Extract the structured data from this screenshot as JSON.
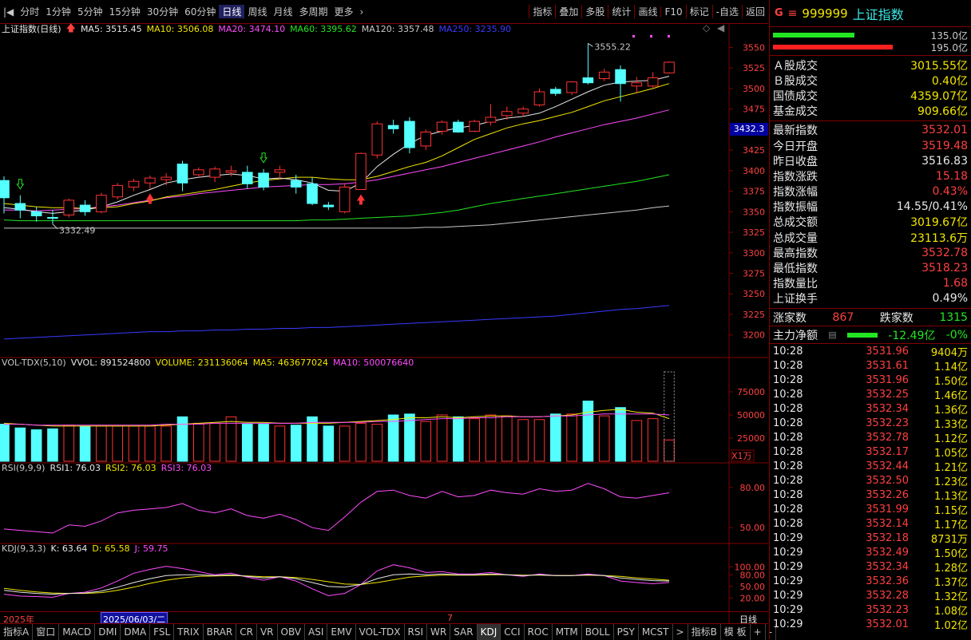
{
  "toolbar": {
    "periods": [
      "分时",
      "1分钟",
      "5分钟",
      "15分钟",
      "30分钟",
      "60分钟",
      "日线",
      "周线",
      "月线",
      "多周期",
      "更多"
    ],
    "active_period": "日线",
    "right_buttons": [
      "指标",
      "叠加",
      "多股",
      "统计",
      "画线",
      "F10",
      "标记",
      "-自选",
      "返回"
    ]
  },
  "main_chart": {
    "title": "上证指数(日线)",
    "ma_labels": [
      {
        "text": "MA5: 3515.45",
        "color": "#e8e8e8"
      },
      {
        "text": "MA10: 3506.08",
        "color": "#f2e600"
      },
      {
        "text": "MA20: 3474.10",
        "color": "#ff4cff"
      },
      {
        "text": "MA60: 3395.62",
        "color": "#22e622"
      },
      {
        "text": "MA120: 3357.48",
        "color": "#c8c8c8"
      },
      {
        "text": "MA250: 3235.90",
        "color": "#3a3aff"
      }
    ],
    "high_label": "3555.22",
    "low_label": "3332.49",
    "current_price_tag": "3432.3",
    "y_ticks": [
      "3550",
      "3525",
      "3500",
      "3475",
      "3450",
      "3425",
      "3400",
      "3375",
      "3350",
      "3325",
      "3300",
      "3275",
      "3250",
      "3225",
      "3200"
    ]
  },
  "vol_panel": {
    "labels": [
      {
        "text": "VOL-TDX(5,10)",
        "color": "#c8c8c8"
      },
      {
        "text": "VVOL: 891524800",
        "color": "#e8e8e8"
      },
      {
        "text": "VOLUME: 231136064",
        "color": "#f2e600"
      },
      {
        "text": "MA5: 463677024",
        "color": "#f2e600"
      },
      {
        "text": "MA10: 500076640",
        "color": "#ff4cff"
      }
    ],
    "y_ticks": [
      "75000",
      "50000",
      "25000"
    ],
    "unit": "X1万"
  },
  "rsi_panel": {
    "labels": [
      {
        "text": "RSI(9,9,9)",
        "color": "#c8c8c8"
      },
      {
        "text": "RSI1: 76.03",
        "color": "#e8e8e8"
      },
      {
        "text": "RSI2: 76.03",
        "color": "#f2e600"
      },
      {
        "text": "RSI3: 76.03",
        "color": "#ff4cff"
      }
    ],
    "y_ticks": [
      "80.00",
      "50.00"
    ]
  },
  "kdj_panel": {
    "labels": [
      {
        "text": "KDJ(9,3,3)",
        "color": "#c8c8c8"
      },
      {
        "text": "K: 63.64",
        "color": "#e8e8e8"
      },
      {
        "text": "D: 65.58",
        "color": "#f2e600"
      },
      {
        "text": "J: 59.75",
        "color": "#ff4cff"
      }
    ],
    "y_ticks": [
      "100.00",
      "80.00",
      "50.00",
      "20.00"
    ]
  },
  "time_axis": {
    "year": "2025年",
    "date_tag": "2025/06/03/二",
    "month_mark": "7",
    "period": "日线"
  },
  "bottom_tabs": [
    "指标A",
    "窗口",
    "MACD",
    "DMI",
    "DMA",
    "FSL",
    "TRIX",
    "BRAR",
    "CR",
    "VR",
    "OBV",
    "ASI",
    "EMV",
    "VOL-TDX",
    "RSI",
    "WR",
    "SAR",
    "KDJ",
    "CCI",
    "ROC",
    "MTM",
    "BOLL",
    "PSY",
    "MCST"
  ],
  "bottom_tabs_active": "KDJ",
  "bottom_right": [
    "指标B",
    "模 板",
    "+",
    "-"
  ],
  "quote": {
    "prefix": "G",
    "menu_icon": "≡",
    "code": "999999",
    "name": "上证指数",
    "bar1_value": "135.0亿",
    "bar2_value": "195.0亿",
    "turnover_rows": [
      {
        "k": "Ａ股成交",
        "v": "3015.55亿"
      },
      {
        "k": "Ｂ股成交",
        "v": "0.40亿"
      },
      {
        "k": "国债成交",
        "v": "4359.07亿"
      },
      {
        "k": "基金成交",
        "v": "909.66亿"
      }
    ],
    "index_rows": [
      {
        "k": "最新指数",
        "v": "3532.01",
        "c": "#ff4040"
      },
      {
        "k": "今日开盘",
        "v": "3519.48",
        "c": "#ff4040"
      },
      {
        "k": "昨日收盘",
        "v": "3516.83",
        "c": "#e8e8e8"
      },
      {
        "k": "指数涨跌",
        "v": "15.18",
        "c": "#ff4040"
      },
      {
        "k": "指数涨幅",
        "v": "0.43%",
        "c": "#ff4040"
      },
      {
        "k": "指数振幅",
        "v": "14.55/0.41%",
        "c": "#e8e8e8"
      },
      {
        "k": "总成交额",
        "v": "3019.67亿",
        "c": "#f2e600"
      },
      {
        "k": "总成交量",
        "v": "23113.6万",
        "c": "#f2e600"
      },
      {
        "k": "最高指数",
        "v": "3532.78",
        "c": "#ff4040"
      },
      {
        "k": "最低指数",
        "v": "3518.23",
        "c": "#ff4040"
      },
      {
        "k": "指数量比",
        "v": "1.68",
        "c": "#ff4040"
      },
      {
        "k": "上证换手",
        "v": "0.49%",
        "c": "#e8e8e8"
      }
    ],
    "breadth": {
      "up_label": "涨家数",
      "up": "867",
      "down_label": "跌家数",
      "down": "1315"
    },
    "mainflow": {
      "label": "主力净额",
      "value": "-12.49亿",
      "pct": "-0%"
    },
    "ticks": [
      {
        "t": "10:28",
        "p": "3531.96",
        "v": "9404万"
      },
      {
        "t": "10:28",
        "p": "3531.61",
        "v": "1.14亿"
      },
      {
        "t": "10:28",
        "p": "3531.96",
        "v": "1.50亿"
      },
      {
        "t": "10:28",
        "p": "3532.25",
        "v": "1.46亿"
      },
      {
        "t": "10:28",
        "p": "3532.34",
        "v": "1.36亿"
      },
      {
        "t": "10:28",
        "p": "3532.23",
        "v": "1.33亿"
      },
      {
        "t": "10:28",
        "p": "3532.78",
        "v": "1.12亿"
      },
      {
        "t": "10:28",
        "p": "3532.17",
        "v": "1.05亿"
      },
      {
        "t": "10:28",
        "p": "3532.44",
        "v": "1.21亿"
      },
      {
        "t": "10:28",
        "p": "3532.50",
        "v": "1.23亿"
      },
      {
        "t": "10:28",
        "p": "3532.26",
        "v": "1.13亿"
      },
      {
        "t": "10:28",
        "p": "3531.99",
        "v": "1.15亿"
      },
      {
        "t": "10:28",
        "p": "3532.14",
        "v": "1.17亿"
      },
      {
        "t": "10:29",
        "p": "3532.18",
        "v": "8731万"
      },
      {
        "t": "10:29",
        "p": "3532.49",
        "v": "1.50亿"
      },
      {
        "t": "10:29",
        "p": "3532.34",
        "v": "1.28亿"
      },
      {
        "t": "10:29",
        "p": "3532.36",
        "v": "1.37亿"
      },
      {
        "t": "10:29",
        "p": "3532.28",
        "v": "1.32亿"
      },
      {
        "t": "10:29",
        "p": "3532.23",
        "v": "1.08亿"
      },
      {
        "t": "10:29",
        "p": "3532.01",
        "v": "1.02亿"
      }
    ]
  },
  "chart_data": {
    "type": "candlestick",
    "candles": [
      [
        3388,
        3393,
        3348,
        3367
      ],
      [
        3360,
        3370,
        3342,
        3352
      ],
      [
        3350,
        3356,
        3338,
        3345
      ],
      [
        3343,
        3352,
        3335,
        3342
      ],
      [
        3346,
        3366,
        3343,
        3364
      ],
      [
        3358,
        3364,
        3345,
        3350
      ],
      [
        3350,
        3373,
        3348,
        3370
      ],
      [
        3368,
        3385,
        3365,
        3382
      ],
      [
        3380,
        3390,
        3375,
        3387
      ],
      [
        3385,
        3394,
        3378,
        3391
      ],
      [
        3389,
        3397,
        3382,
        3392
      ],
      [
        3408,
        3412,
        3375,
        3385
      ],
      [
        3395,
        3404,
        3392,
        3401
      ],
      [
        3392,
        3405,
        3386,
        3402
      ],
      [
        3398,
        3406,
        3393,
        3400
      ],
      [
        3398,
        3406,
        3378,
        3384
      ],
      [
        3397,
        3402,
        3376,
        3380
      ],
      [
        3398,
        3406,
        3389,
        3401
      ],
      [
        3388,
        3395,
        3372,
        3380
      ],
      [
        3384,
        3392,
        3358,
        3360
      ],
      [
        3358,
        3362,
        3352,
        3356
      ],
      [
        3350,
        3385,
        3348,
        3380
      ],
      [
        3377,
        3422,
        3377,
        3421
      ],
      [
        3419,
        3460,
        3415,
        3457
      ],
      [
        3455,
        3462,
        3445,
        3451
      ],
      [
        3460,
        3465,
        3421,
        3428
      ],
      [
        3430,
        3450,
        3425,
        3447
      ],
      [
        3448,
        3461,
        3444,
        3459
      ],
      [
        3459,
        3462,
        3446,
        3447
      ],
      [
        3448,
        3462,
        3447,
        3460
      ],
      [
        3459,
        3481,
        3455,
        3465
      ],
      [
        3467,
        3478,
        3462,
        3472
      ],
      [
        3470,
        3478,
        3466,
        3475
      ],
      [
        3480,
        3500,
        3478,
        3496
      ],
      [
        3499,
        3502,
        3491,
        3494
      ],
      [
        3495,
        3509,
        3492,
        3508
      ],
      [
        3513,
        3555,
        3505,
        3507
      ],
      [
        3512,
        3524,
        3509,
        3520
      ],
      [
        3523,
        3528,
        3484,
        3506
      ],
      [
        3503,
        3514,
        3494,
        3507
      ],
      [
        3503,
        3520,
        3501,
        3513
      ],
      [
        3519,
        3533,
        3518,
        3532
      ]
    ],
    "ma5": [
      3355,
      3353,
      3350,
      3348,
      3350,
      3352,
      3356,
      3362,
      3370,
      3377,
      3385,
      3389,
      3392,
      3394,
      3396,
      3394,
      3390,
      3391,
      3389,
      3385,
      3376,
      3375,
      3385,
      3405,
      3420,
      3433,
      3443,
      3448,
      3452,
      3455,
      3460,
      3464,
      3466,
      3470,
      3478,
      3487,
      3496,
      3504,
      3508,
      3509,
      3510,
      3515
    ],
    "ma10": [
      3360,
      3358,
      3356,
      3355,
      3355,
      3354,
      3355,
      3356,
      3360,
      3363,
      3368,
      3371,
      3374,
      3377,
      3381,
      3385,
      3388,
      3390,
      3392,
      3392,
      3390,
      3389,
      3389,
      3393,
      3399,
      3405,
      3410,
      3418,
      3428,
      3438,
      3445,
      3452,
      3457,
      3461,
      3466,
      3471,
      3478,
      3485,
      3490,
      3495,
      3500,
      3506
    ],
    "ma20": [
      3352,
      3352,
      3351,
      3352,
      3353,
      3354,
      3356,
      3358,
      3361,
      3364,
      3367,
      3369,
      3372,
      3374,
      3376,
      3378,
      3380,
      3381,
      3382,
      3383,
      3383,
      3384,
      3386,
      3389,
      3393,
      3397,
      3401,
      3405,
      3410,
      3415,
      3420,
      3425,
      3430,
      3435,
      3441,
      3446,
      3451,
      3456,
      3460,
      3464,
      3469,
      3474
    ],
    "ma60": [
      3340,
      3339,
      3339,
      3339,
      3339,
      3339,
      3339,
      3339,
      3339,
      3339,
      3339,
      3339,
      3339,
      3339,
      3339,
      3339,
      3339,
      3339,
      3339,
      3340,
      3340,
      3341,
      3342,
      3343,
      3344,
      3345,
      3347,
      3349,
      3352,
      3356,
      3360,
      3363,
      3366,
      3369,
      3372,
      3375,
      3378,
      3381,
      3384,
      3387,
      3391,
      3395
    ],
    "ma120": [
      3330,
      3330,
      3330,
      3330,
      3330,
      3330,
      3330,
      3330,
      3330,
      3330,
      3330,
      3330,
      3330,
      3330,
      3330,
      3330,
      3330,
      3330,
      3330,
      3330,
      3330,
      3330,
      3330,
      3330,
      3330,
      3330,
      3331,
      3331,
      3332,
      3333,
      3334,
      3336,
      3338,
      3340,
      3342,
      3344,
      3346,
      3348,
      3350,
      3352,
      3355,
      3357
    ],
    "ma250": [
      3195,
      3196,
      3197,
      3198,
      3199,
      3200,
      3201,
      3202,
      3203,
      3204,
      3204,
      3205,
      3205,
      3206,
      3206,
      3207,
      3207,
      3208,
      3208,
      3209,
      3209,
      3210,
      3211,
      3212,
      3213,
      3214,
      3215,
      3216,
      3217,
      3218,
      3219,
      3220,
      3221,
      3222,
      3223,
      3225,
      3227,
      3229,
      3231,
      3232,
      3234,
      3236
    ],
    "volume": [
      40000,
      36000,
      34000,
      35000,
      39000,
      38000,
      38000,
      38000,
      38000,
      38000,
      38000,
      48000,
      41000,
      41000,
      48000,
      40000,
      40000,
      38000,
      39000,
      48000,
      38000,
      38000,
      41000,
      40000,
      50000,
      51000,
      43000,
      50000,
      48000,
      46000,
      50000,
      49000,
      45000,
      45000,
      51000,
      51000,
      65000,
      49000,
      58000,
      44000,
      46000,
      23000
    ],
    "vol_ma5": [
      41000,
      40000,
      39000,
      38000,
      38000,
      38000,
      38000,
      38000,
      38000,
      38000,
      39000,
      40000,
      41000,
      42000,
      43000,
      42000,
      42000,
      41000,
      41000,
      41000,
      41000,
      42000,
      43000,
      44000,
      45000,
      47000,
      47000,
      48000,
      47000,
      48000,
      49000,
      49000,
      48000,
      48000,
      49000,
      50000,
      53000,
      55000,
      56000,
      53000,
      52000,
      46000
    ],
    "vol_ma10": [
      40000,
      40000,
      39000,
      39000,
      39000,
      39000,
      39000,
      39000,
      39000,
      39000,
      40000,
      40000,
      40000,
      41000,
      41000,
      41000,
      41000,
      41000,
      41000,
      42000,
      42000,
      42000,
      42000,
      43000,
      43000,
      44000,
      45000,
      46000,
      46000,
      47000,
      47000,
      48000,
      48000,
      48000,
      49000,
      49000,
      50000,
      51000,
      51000,
      51000,
      51000,
      50000
    ],
    "rsi": [
      49,
      48,
      47,
      46,
      52,
      51,
      55,
      61,
      63,
      64,
      65,
      68,
      63,
      61,
      64,
      59,
      57,
      60,
      56,
      50,
      48,
      58,
      69,
      77,
      78,
      74,
      72,
      77,
      73,
      74,
      78,
      76,
      75,
      79,
      77,
      78,
      83,
      79,
      73,
      72,
      74,
      76
    ],
    "kdj_k": [
      40,
      35,
      32,
      30,
      32,
      33,
      38,
      48,
      60,
      70,
      78,
      80,
      80,
      78,
      80,
      76,
      72,
      75,
      70,
      60,
      50,
      48,
      55,
      70,
      80,
      82,
      80,
      82,
      80,
      80,
      82,
      80,
      78,
      80,
      78,
      78,
      80,
      78,
      72,
      68,
      65,
      64
    ],
    "kdj_d": [
      45,
      40,
      36,
      33,
      32,
      32,
      34,
      40,
      48,
      58,
      66,
      72,
      76,
      77,
      78,
      77,
      75,
      75,
      73,
      68,
      62,
      56,
      55,
      60,
      67,
      74,
      77,
      79,
      79,
      79,
      80,
      80,
      79,
      79,
      78,
      78,
      79,
      78,
      76,
      72,
      69,
      66
    ],
    "kdj_j": [
      30,
      25,
      24,
      22,
      32,
      35,
      46,
      64,
      84,
      94,
      102,
      96,
      88,
      80,
      84,
      74,
      66,
      75,
      64,
      44,
      26,
      32,
      55,
      90,
      106,
      98,
      86,
      88,
      82,
      82,
      86,
      80,
      76,
      82,
      78,
      78,
      82,
      78,
      64,
      60,
      57,
      60
    ],
    "price_range": [
      3190,
      3565
    ],
    "vol_range": [
      0,
      100000
    ],
    "rsi_range": [
      40,
      90
    ],
    "kdj_range": [
      -10,
      130
    ]
  }
}
